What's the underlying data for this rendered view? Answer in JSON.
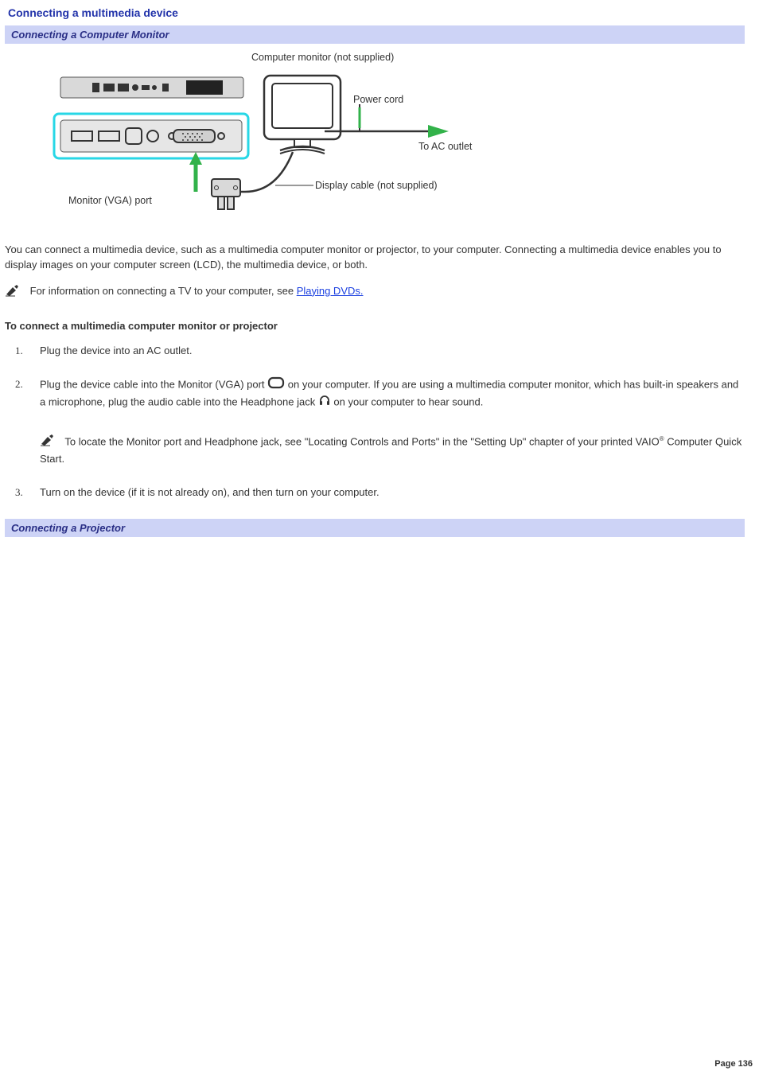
{
  "page_title": "Connecting a multimedia device",
  "section1": "Connecting a Computer Monitor",
  "section2": "Connecting a Projector",
  "diagram": {
    "monitor_label": "Computer monitor (not supplied)",
    "power_cord": "Power cord",
    "to_ac": "To AC outlet",
    "display_cable": "Display cable (not supplied)",
    "vga_port": "Monitor (VGA) port"
  },
  "intro_para": "You can connect a multimedia device, such as a multimedia computer monitor or projector, to your computer. Connecting a multimedia device enables you to display images on your computer screen (LCD), the multimedia device, or both.",
  "note_tv_prefix": "For information on connecting a TV to your computer, see ",
  "note_tv_link": "Playing DVDs.",
  "sub_heading": "To connect a multimedia computer monitor or projector",
  "steps": {
    "s1": "Plug the device into an AC outlet.",
    "s2a": "Plug the device cable into the Monitor (VGA) port ",
    "s2b": " on your computer. If you are using a multimedia computer monitor, which has built-in speakers and a microphone, plug the audio cable into the Headphone jack ",
    "s2c": " on your computer to hear sound.",
    "s2_note_a": " To locate the Monitor port and Headphone jack, see \"Locating Controls and Ports\" in the \"Setting Up\" chapter of your printed VAIO",
    "s2_note_b": " Computer Quick Start.",
    "s3": "Turn on the device (if it is not already on), and then turn on your computer."
  },
  "page_number": "Page 136"
}
